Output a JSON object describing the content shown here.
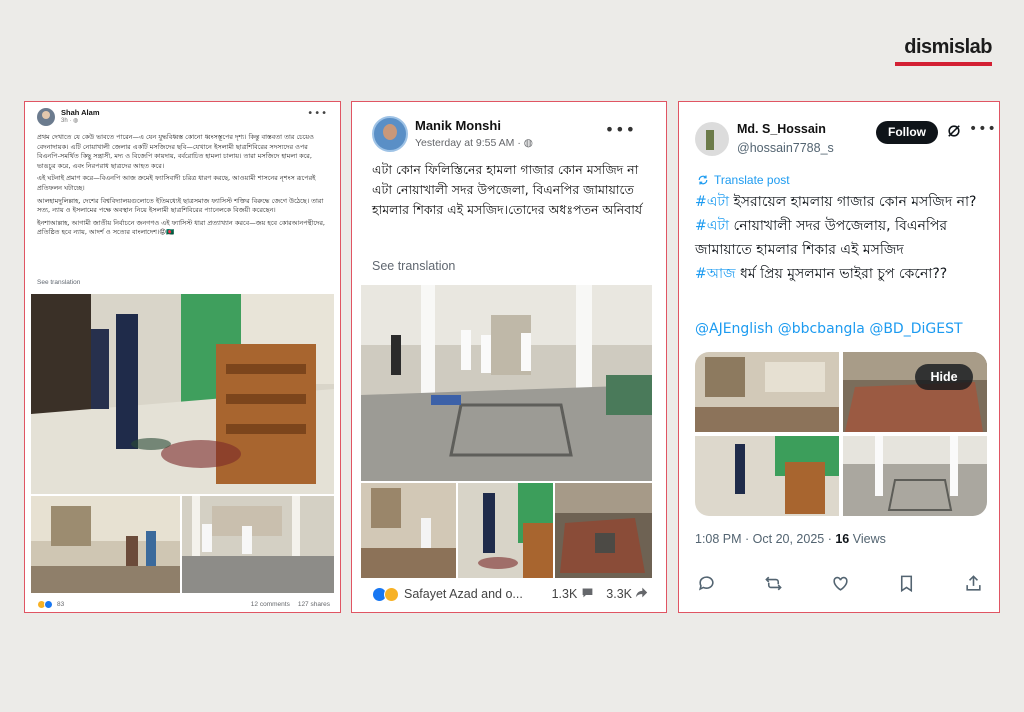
{
  "brand": {
    "logo_text": "dismislab",
    "accent_color": "#d32033"
  },
  "post1": {
    "author": "Shah Alam",
    "time": "3h · ",
    "paragraphs": [
      "প্রথম দেখাতে যে কেউ ভাবতে পারেন—এ যেন যুদ্ধবিধ্বস্ত কোনো ধ্বংসস্তূপের দৃশ্য। কিন্তু বাস্তবতা তার চেয়েও বেদনাদায়ক। এটি নোয়াখালী জেলার একটি মসজিদের ছবি—যেখানে ইসলামী ছাত্রশিবিরের সদস্যদের ওপর বিএনপি-সমর্থিত কিছু সন্ত্রাসী, মদ্য ও বিজেপি কায়দায়, বর্বরোচিত হামলা চালায়। তারা মসজিদে হামলা করে, ভাঙচুর করে, এবং নিরপরাধ ছাত্রদের আহত করে।",
      "এই ঘটনাই প্রমাণ করে—বিএনপি আজ ক্রমেই ফ্যাসিবাদী চরিত্র ধারণ করছে, আওয়ামী শাসনের নৃশংস রূপেরই প্রতিফলন ঘটাচ্ছে।",
      "আলহামদুলিল্লাহ, দেশের বিশ্ববিদ্যালয়গুলোতে ইতিমধ্যেই ছাত্রসমাজ ফ্যাসিস্ট শক্তির বিরুদ্ধে জেগে উঠেছে। তারা সত্য, ন্যায় ও ইসলামের পক্ষে অবস্থান নিয়ে ইসলামী ছাত্রশিবিরের প্যানেলকে বিজয়ী করেছেন।",
      "ইনশাআল্লাহ, আগামী জাতীয় নির্বাচনে জনগণও এই ফ্যাসিস্ট ধারা প্রত্যাখ্যান করবে—জয় হবে কোরআনপন্থীদের, প্রতিষ্ঠিত হবে ন্যায়, আদর্শ ও সত্যের বাংলাদেশ।😡🇧🇩"
    ],
    "see_translation": "See translation",
    "reaction_count": "83",
    "comments": "12 comments",
    "shares": "127 shares"
  },
  "post2": {
    "author": "Manik Monshi",
    "time": "Yesterday at 9:55 AM · ",
    "text_lines": [
      "এটা কোন ফিলিস্তিনের হামলা গাজার কোন মসজিদ না",
      "এটা নোয়াখালী সদর উপজেলা, বিএনপির জামায়াতে হামলার শিকার এই মসজিদ।তোদের অধঃপতন অনিবার্য"
    ],
    "see_translation": "See translation",
    "reactors": "Safayet Azad and o...",
    "comments": "1.3K",
    "shares": "3.3K"
  },
  "post3": {
    "author": "Md. S_Hossain",
    "handle": "@hossain7788_s",
    "follow_label": "Follow",
    "translate_label": "Translate post",
    "line1_hash": "#এটা",
    "line1_text": " ইসরায়েল হামলায় গাজার কোন মসজিদ না?",
    "line2_hash": "#এটা",
    "line2_text": " নোয়াখালী সদর উপজেলায়, বিএনপির জামায়াতে হামলার শিকার এই মসজিদ",
    "line3_hash": "#আজ",
    "line3_text": " ধর্ম প্রিয় মুসলমান ভাইরা চুপ কেনো??",
    "mentions": "@AJEnglish @bbcbangla @BD_DiGEST",
    "hide_label": "Hide",
    "timestamp": "1:08 PM · Oct 20, 2025 · ",
    "views_count": "16",
    "views_label": " Views"
  }
}
